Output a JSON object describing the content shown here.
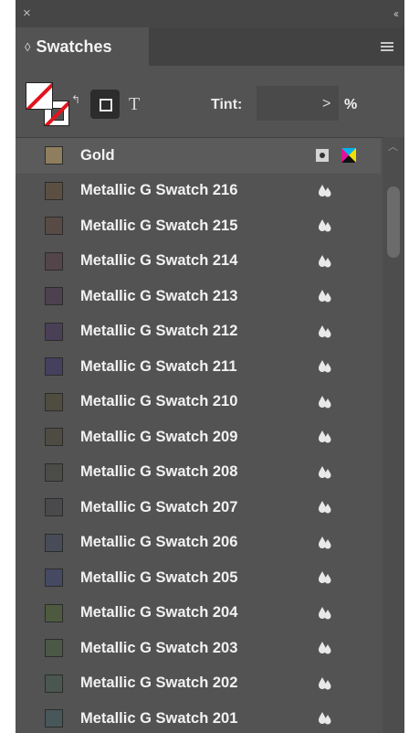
{
  "titlebar": {
    "close_glyph": "×",
    "collapse_glyph": "‹‹"
  },
  "panel": {
    "title": "Swatches",
    "tab_chevron": "◊"
  },
  "toolbar": {
    "format_text_glyph": "T",
    "tint_label": "Tint:",
    "tint_value": "",
    "tint_arrow": ">",
    "tint_unit": "%"
  },
  "swatches": [
    {
      "name": "Gold",
      "color": "#8e7e5e",
      "type": "spot-cmyk"
    },
    {
      "name": "Metallic G Swatch 216",
      "color": "#5b4f42",
      "type": "mixed-ink"
    },
    {
      "name": "Metallic G Swatch 215",
      "color": "#584a45",
      "type": "mixed-ink"
    },
    {
      "name": "Metallic G Swatch 214",
      "color": "#534549",
      "type": "mixed-ink"
    },
    {
      "name": "Metallic G Swatch 213",
      "color": "#4d4150",
      "type": "mixed-ink"
    },
    {
      "name": "Metallic G Swatch 212",
      "color": "#4a4055",
      "type": "mixed-ink"
    },
    {
      "name": "Metallic G Swatch 211",
      "color": "#44405e",
      "type": "mixed-ink"
    },
    {
      "name": "Metallic G Swatch 210",
      "color": "#4f4d3f",
      "type": "mixed-ink"
    },
    {
      "name": "Metallic G Swatch 209",
      "color": "#4e4c42",
      "type": "mixed-ink"
    },
    {
      "name": "Metallic G Swatch 208",
      "color": "#4b4b47",
      "type": "mixed-ink"
    },
    {
      "name": "Metallic G Swatch 207",
      "color": "#4a4a4d",
      "type": "mixed-ink"
    },
    {
      "name": "Metallic G Swatch 206",
      "color": "#484b58",
      "type": "mixed-ink"
    },
    {
      "name": "Metallic G Swatch 205",
      "color": "#454962",
      "type": "mixed-ink"
    },
    {
      "name": "Metallic G Swatch 204",
      "color": "#4d5a3f",
      "type": "mixed-ink"
    },
    {
      "name": "Metallic G Swatch 203",
      "color": "#4b5846",
      "type": "mixed-ink"
    },
    {
      "name": "Metallic G Swatch 202",
      "color": "#4a5650",
      "type": "mixed-ink"
    },
    {
      "name": "Metallic G Swatch 201",
      "color": "#47575a",
      "type": "mixed-ink"
    }
  ],
  "icons": {
    "close": "close-icon",
    "collapse": "collapse-panel-icon",
    "menu": "panel-menu-icon",
    "fill_stroke": "fill-stroke-none-icon",
    "swap": "swap-fill-stroke-icon",
    "format_container": "format-container-icon",
    "format_text": "format-text-icon",
    "mixed_ink": "mixed-ink-icon",
    "spot": "spot-color-icon",
    "cmyk": "cmyk-mode-icon"
  },
  "accent_colors": {
    "none_slash": "#e0141e",
    "panel_bg": "#535353",
    "titlebar_bg": "#464646"
  }
}
